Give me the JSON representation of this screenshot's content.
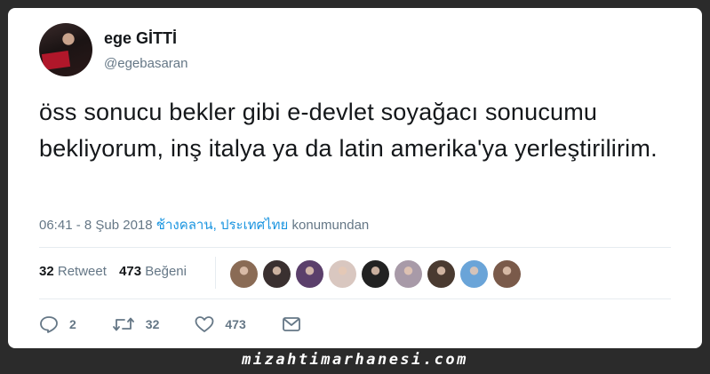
{
  "tweet": {
    "display_name": "ege GİTTİ",
    "handle": "@egebasaran",
    "text": "öss sonucu bekler gibi e-devlet soyağacı sonucumu bekliyorum, inş italya ya da latin amerika'ya yerleştirilirim.",
    "timestamp": "06:41 - 8 Şub 2018",
    "location": "ช้างคลาน, ประเทศไทย",
    "location_suffix": "konumundan"
  },
  "stats": {
    "retweets_count": "32",
    "retweets_label": "Retweet",
    "likes_count": "473",
    "likes_label": "Beğeni"
  },
  "likers": [
    {
      "icon": "avatar",
      "color": "#8a6b55"
    },
    {
      "icon": "avatar",
      "color": "#3a3030"
    },
    {
      "icon": "avatar",
      "color": "#5b3f6b"
    },
    {
      "icon": "avatar",
      "color": "#d9c7c0"
    },
    {
      "icon": "avatar",
      "color": "#222222"
    },
    {
      "icon": "avatar",
      "color": "#a89aa8"
    },
    {
      "icon": "avatar",
      "color": "#4a3a30"
    },
    {
      "icon": "avatar",
      "color": "#6aa4d8"
    },
    {
      "icon": "avatar",
      "color": "#7a5a4a"
    }
  ],
  "actions": {
    "reply_count": "2",
    "retweet_count": "32",
    "like_count": "473"
  },
  "watermark": "mizahtimarhanesi.com",
  "colors": {
    "accent": "#1b95e0",
    "text": "#14171a",
    "muted": "#657786"
  }
}
